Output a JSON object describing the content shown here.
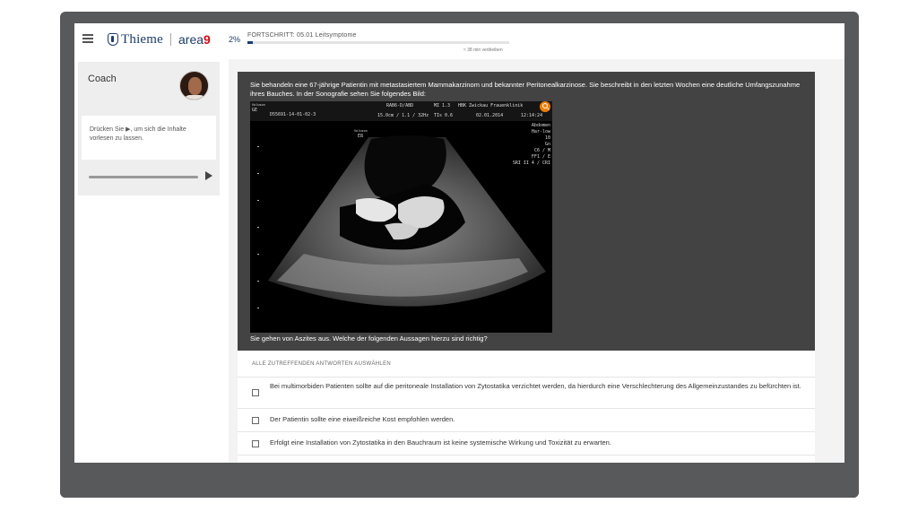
{
  "header": {
    "logo_brand": "Thieme",
    "logo_area": "area",
    "logo_nine": "9",
    "progress_percent": "2%",
    "progress_fraction": 0.02,
    "progress_label": "FORTSCHRITT: 05.01 Leitsymptome",
    "remaining": "≈ 38 min verbleiben"
  },
  "coach": {
    "title": "Coach",
    "text": "Drücken Sie ▶, um sich die Inhalte vorlesen zu lassen."
  },
  "question": {
    "text": "Sie behandeln eine 67-jährige Patientin mit metastasiertem Mammakarzinom und bekannter Peritonealkarzinose. Sie beschreibt in den letzten Wochen eine deutliche Umfangszunahme ihres Bauches. In der Sonografie sehen Sie folgendes Bild:",
    "followup": "Sie gehen von Aszites aus. Welche der folgenden Aussagen hierzu sind richtig?",
    "image_overlay": {
      "probe": "RAB6-D/ABD",
      "mi": "MI 1.3",
      "clinic": "HBK Zwickau Frauenklinik",
      "patient_id": "D55691-14-01-02-3",
      "depth": "15.0cm / 1.1 / 32Hz",
      "tis": "TIs 0.6",
      "date": "02.01.2014",
      "time": "12:14:24",
      "ge": "GE",
      "voluson": "Voluson",
      "e8": "E8",
      "r1": "Abdomen",
      "r2": "Har-low",
      "r3": "10",
      "r4": "Gn",
      "r5": "C6 / M",
      "r6": "FF1 / E",
      "r7": "SRI II 4 / CRI"
    }
  },
  "answers": {
    "hint": "ALLE ZUTREFFENDEN ANTWORTEN AUSWÄHLEN",
    "items": [
      {
        "text": "Bei multimorbiden Patienten sollte auf die peritoneale Installation von Zytostatika verzichtet werden, da hierdurch eine Verschlechterung des Allgemeinzustandes zu befürchten ist."
      },
      {
        "text": "Der Patientin sollte eine eiweißreiche Kost empfohlen werden."
      },
      {
        "text": "Erfolgt eine Installation von Zytostatika in den Bauchraum ist keine systemische Wirkung und Toxizität zu erwarten."
      }
    ]
  },
  "colors": {
    "brand": "#1a3c6e",
    "accent": "#e30613",
    "zoom": "#f07d00",
    "question_bg": "#434343"
  }
}
